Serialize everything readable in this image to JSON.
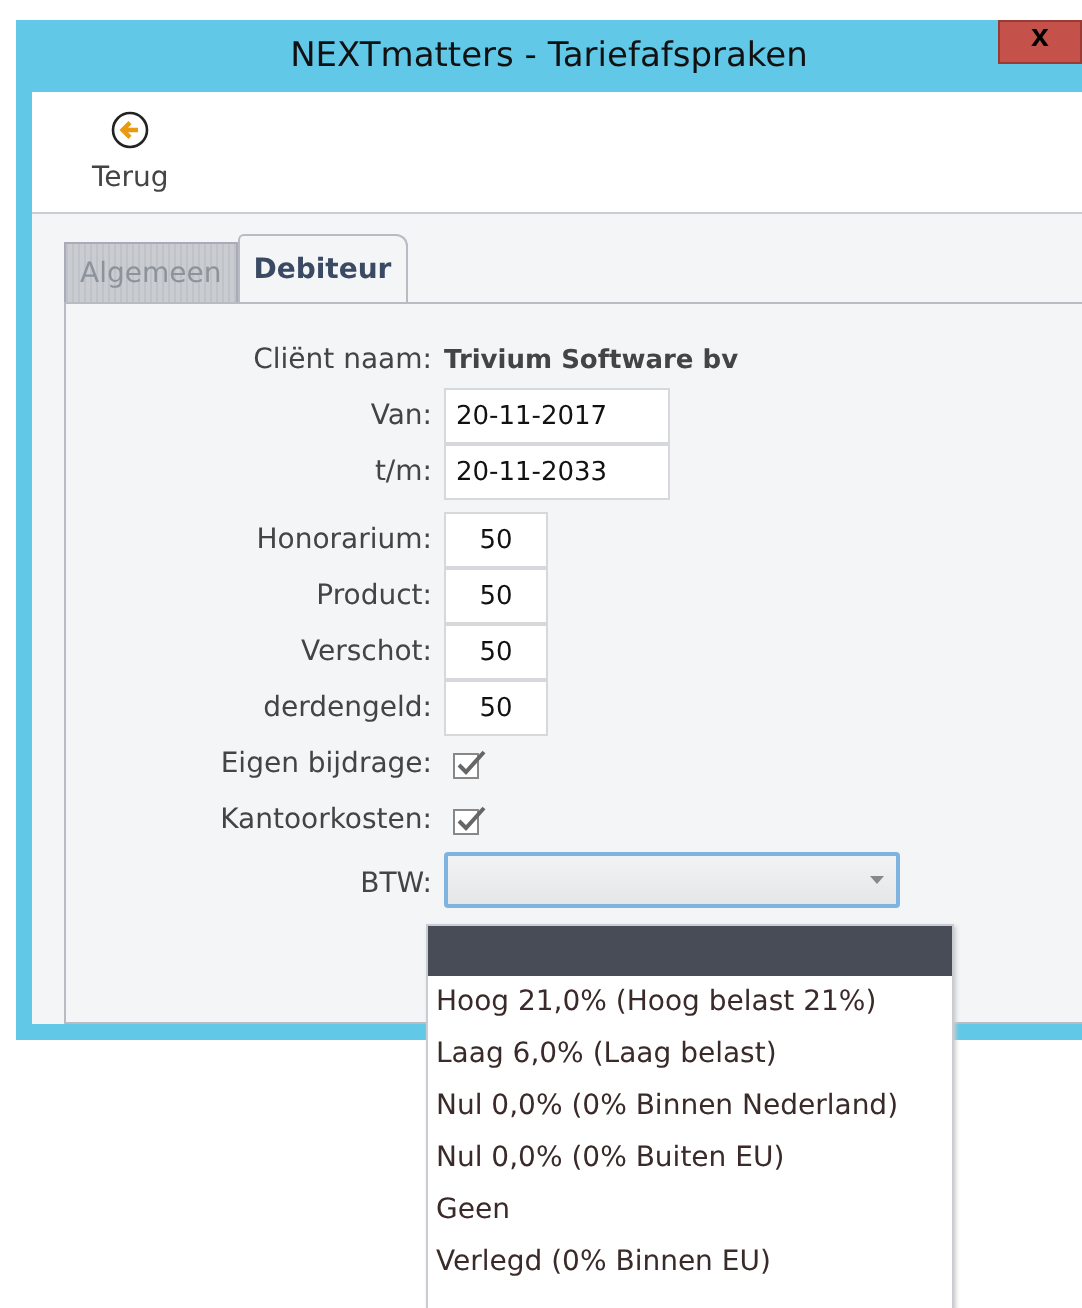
{
  "window": {
    "title": "NEXTmatters - Tariefafspraken",
    "close": "x"
  },
  "toolbar": {
    "back_button": "Terug"
  },
  "tabs": [
    {
      "label": "Algemeen",
      "selected": false
    },
    {
      "label": "Debiteur",
      "selected": true
    }
  ],
  "form": {
    "client": {
      "label": "Cliënt naam:",
      "value": "Trivium Software bv"
    },
    "dates": [
      {
        "label": "Van:",
        "value": "20-11-2017"
      },
      {
        "label": "t/m:",
        "value": "20-11-2033"
      }
    ],
    "amounts": [
      {
        "label": "Honorarium:",
        "value": "50"
      },
      {
        "label": "Product:",
        "value": "50"
      },
      {
        "label": "Verschot:",
        "value": "50"
      },
      {
        "label": "derdengeld:",
        "value": "50"
      }
    ],
    "checks": [
      {
        "label": "Eigen bijdrage:",
        "checked": true
      },
      {
        "label": "Kantoorkosten:",
        "checked": true
      }
    ],
    "btw": {
      "label": "BTW:",
      "expanded": true,
      "blank_option_selected": true,
      "options": [
        {
          "label": "Hoog 21,0% (Hoog belast 21%)",
          "selected": false
        },
        {
          "label": "Laag 6,0% (Laag belast)",
          "selected": false
        },
        {
          "label": "Nul 0,0% (0% Binnen Nederland)",
          "selected": false
        },
        {
          "label": "Nul 0,0% (0% Buiten EU)",
          "selected": false
        },
        {
          "label": "Geen",
          "selected": false
        },
        {
          "label": "Verlegd (0% Binnen EU)",
          "selected": false
        }
      ]
    }
  }
}
